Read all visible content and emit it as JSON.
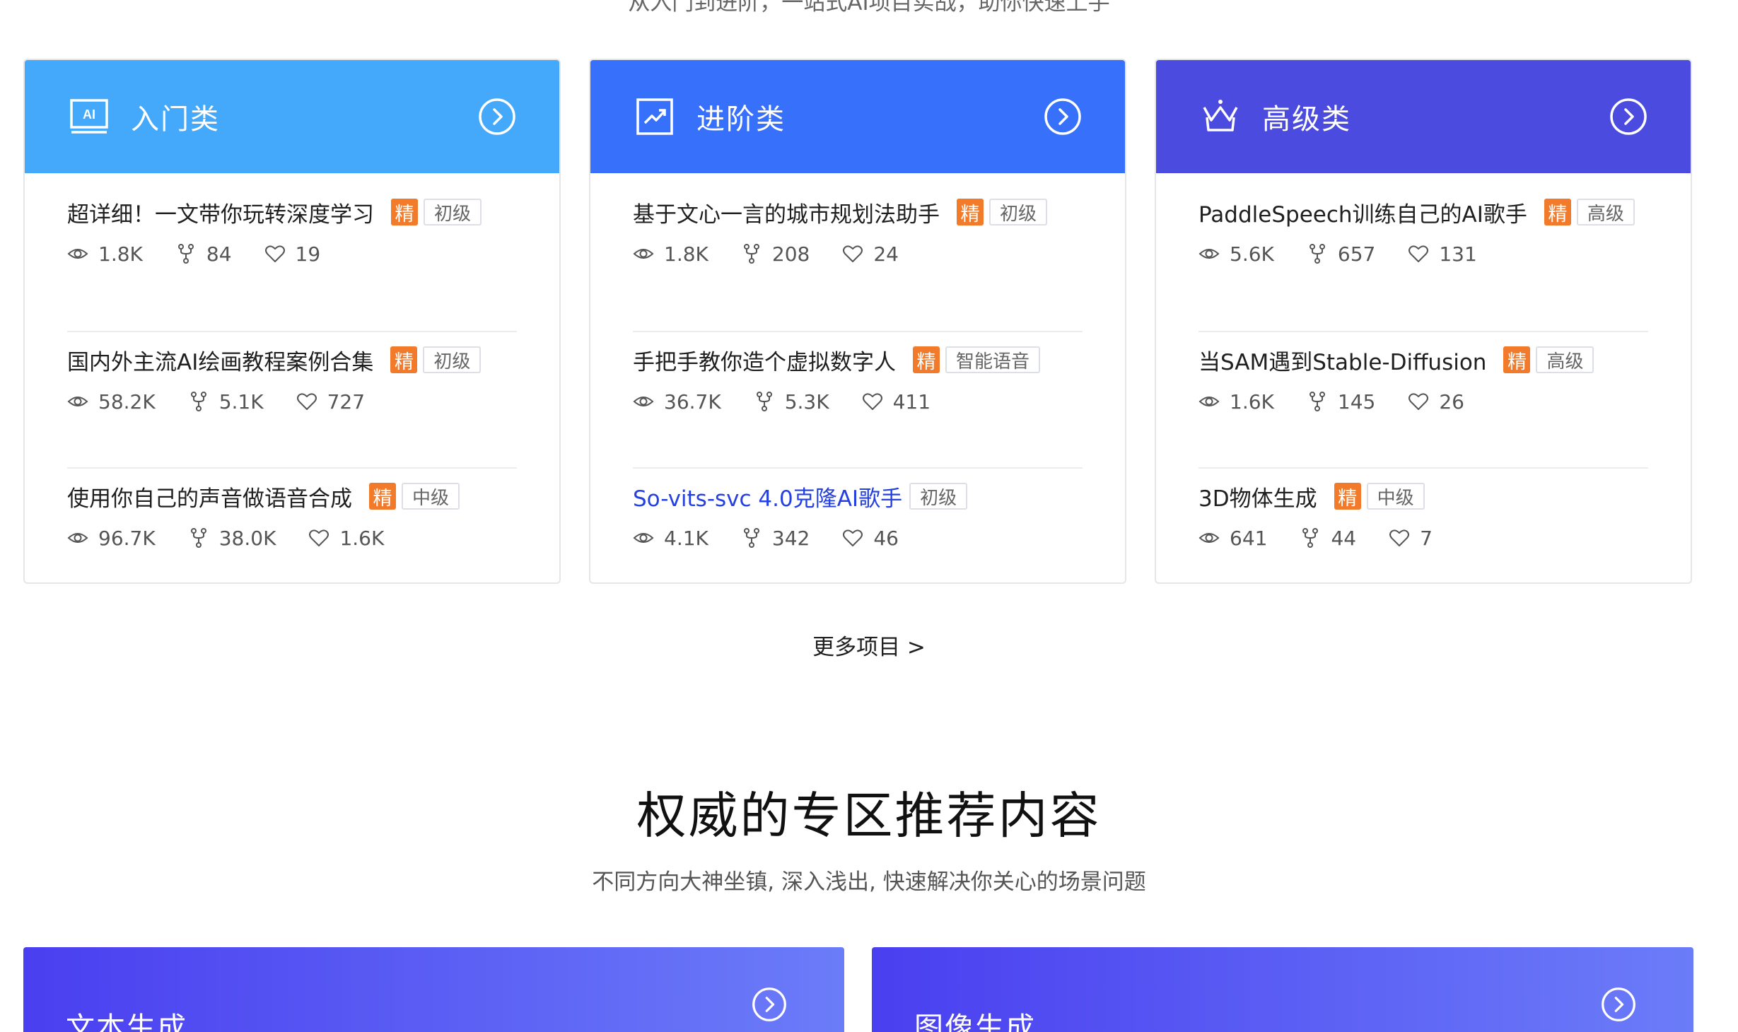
{
  "top_cut_text": "从入门到进阶，一站式AI项目实战，助你快速上手",
  "cards": [
    {
      "title": "入门类",
      "icon": "ai-screen-icon",
      "color": "#44a8fb",
      "items": [
        {
          "title": "超详细！一文带你玩转深度学习",
          "tag": "精",
          "level": "初级",
          "views": "1.8K",
          "forks": "84",
          "likes": "19"
        },
        {
          "title": "国内外主流AI绘画教程案例合集",
          "tag": "精",
          "level": "初级",
          "views": "58.2K",
          "forks": "5.1K",
          "likes": "727"
        },
        {
          "title": "使用你自己的声音做语音合成",
          "tag": "精",
          "level": "中级",
          "views": "96.7K",
          "forks": "38.0K",
          "likes": "1.6K"
        }
      ]
    },
    {
      "title": "进阶类",
      "icon": "trend-chart-icon",
      "color": "#3670fb",
      "items": [
        {
          "title": "基于文心一言的城市规划法助手",
          "tag": "精",
          "level": "初级",
          "views": "1.8K",
          "forks": "208",
          "likes": "24"
        },
        {
          "title": "手把手教你造个虚拟数字人",
          "tag": "精",
          "level": "智能语音",
          "views": "36.7K",
          "forks": "5.3K",
          "likes": "411"
        },
        {
          "title": "So-vits-svc 4.0克隆AI歌手",
          "tag": "",
          "level": "初级",
          "views": "4.1K",
          "forks": "342",
          "likes": "46"
        }
      ]
    },
    {
      "title": "高级类",
      "icon": "crown-icon",
      "color": "#4b4be0",
      "items": [
        {
          "title": "PaddleSpeech训练自己的AI歌手",
          "tag": "精",
          "level": "高级",
          "views": "5.6K",
          "forks": "657",
          "likes": "131"
        },
        {
          "title": "当SAM遇到Stable-Diffusion",
          "tag": "精",
          "level": "高级",
          "views": "1.6K",
          "forks": "145",
          "likes": "26"
        },
        {
          "title": "3D物体生成",
          "tag": "精",
          "level": "中级",
          "views": "641",
          "forks": "44",
          "likes": "7"
        }
      ]
    }
  ],
  "more_link": "更多项目 >",
  "section": {
    "title": "权威的专区推荐内容",
    "subtitle": "不同方向大神坐镇, 深入浅出, 快速解决你关心的场景问题"
  },
  "zones": [
    {
      "title": "文本生成"
    },
    {
      "title": "图像生成"
    }
  ],
  "colors": {
    "jing_badge": "#f27a2b",
    "link_blue": "#2440e0",
    "zone_gradient_start": "#4a3ff0",
    "zone_gradient_end": "#6b7cf8"
  }
}
